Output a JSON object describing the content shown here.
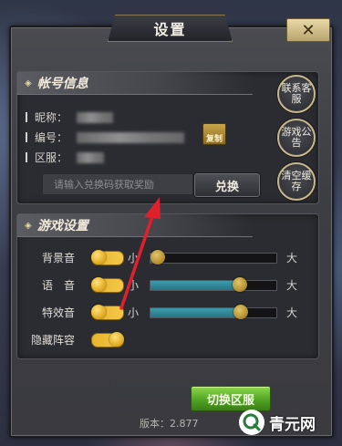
{
  "dialog": {
    "title": "设置",
    "close_symbol": "✕"
  },
  "account": {
    "header": "帐号信息",
    "nickname_label": "昵称：",
    "id_label": "编号：",
    "server_label": "区服：",
    "copy_label": "复制",
    "code_input_placeholder": "请输入兑换码获取奖励",
    "redeem_label": "兑换",
    "side_buttons": [
      "联系客服",
      "游戏公告",
      "清空缓存"
    ]
  },
  "game_settings": {
    "header": "游戏设置",
    "rows": [
      {
        "label": "背景音",
        "toggle_on": true,
        "min_label": "小",
        "max_label": "大",
        "level": 0.06
      },
      {
        "label": "语　音",
        "toggle_on": true,
        "min_label": "小",
        "max_label": "大",
        "level": 0.71
      },
      {
        "label": "特效音",
        "toggle_on": true,
        "min_label": "小",
        "max_label": "大",
        "level": 0.72
      }
    ],
    "hide_lineup_label": "隐藏阵容",
    "hide_lineup_on": true
  },
  "switch_server_label": "切换区服",
  "version_text": "版本：2.877",
  "watermark": {
    "text": "青元网"
  },
  "colors": {
    "accent_gold": "#e0a51c",
    "slider_fill": "#3d9bab",
    "arrow": "#e0202a",
    "switch_green": "#4ea022"
  }
}
